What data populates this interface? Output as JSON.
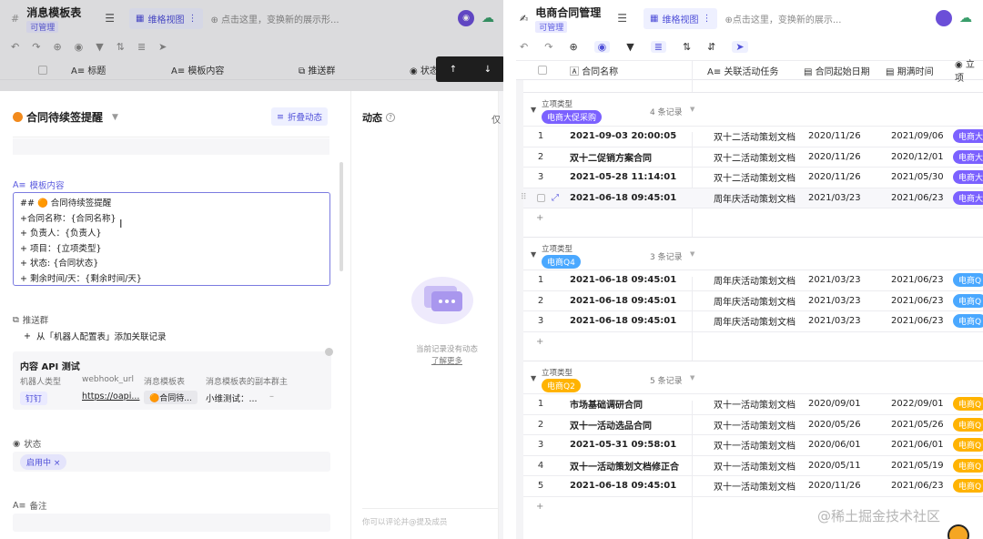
{
  "left": {
    "app_title": "消息模板表",
    "app_sub": "可管理",
    "view_tab": "维格视图",
    "add_view": "点击这里，变换新的展示形...",
    "columns": [
      "标题",
      "模板内容",
      "推送群",
      "状态"
    ],
    "row_title_partial": "合同待续签提醒",
    "record": {
      "title": "合同待续签提醒",
      "collapse": "折叠动态",
      "activity_title": "动态",
      "activity_cut": "仅",
      "template_label": "模板内容",
      "template_lines": [
        "## 🟠 合同待续签提醒",
        "+合同名称：{合同名称}",
        "+ 负责人：{负责人}",
        "+ 项目：{立项类型}",
        "+ 状态: {合同状态}",
        "+ 剩余时间/天：{剩余时间/天}"
      ],
      "push_label": "推送群",
      "add_link": "从「机器人配置表」添加关联记录",
      "linked_title": "内容 API 测试",
      "linked_cols": [
        "机器人类型",
        "webhook_url",
        "消息模板表",
        "消息模板表的副本群主"
      ],
      "linked_vals": [
        "钉钉",
        "https://oapi...",
        "合同待...",
        "小维测试：..."
      ],
      "status_label": "状态",
      "status_value": "启用中",
      "remark_label": "备注",
      "empty_text": "当前记录没有动态",
      "learn_more": "了解更多",
      "comment_placeholder": "你可以评论并@提及成员"
    }
  },
  "right": {
    "app_title": "电商合同管理",
    "app_sub": "可管理",
    "view_tab": "维格视图",
    "add_view": "点击这里，变换新的展示...",
    "columns": [
      "合同名称",
      "关联活动任务",
      "合同起始日期",
      "期满时间",
      "立项"
    ],
    "groups": [
      {
        "label": "立项类型",
        "value": "电商大促采购",
        "count": "4 条记录",
        "tag_color": "#7b61ff",
        "tag_text": "电商大",
        "rows": [
          {
            "n": "1",
            "name": "2021-09-03 20:00:05",
            "task": "双十二活动策划文档",
            "start": "2020/11/26",
            "end": "2021/09/06"
          },
          {
            "n": "",
            "name": "双十二促销方案合同",
            "task": "双十二活动策划文档",
            "start": "2020/11/26",
            "end": "2020/12/01"
          },
          {
            "n": "3",
            "name": "2021-05-28 11:14:01",
            "task": "双十二活动策划文档",
            "start": "2020/11/26",
            "end": "2021/05/30"
          },
          {
            "n": "",
            "name": "2021-06-18 09:45:01",
            "task": "周年庆活动策划文档",
            "start": "2021/03/23",
            "end": "2021/06/23"
          }
        ]
      },
      {
        "label": "立项类型",
        "value": "电商Q4",
        "count": "3 条记录",
        "tag_color": "#4aa8ff",
        "tag_text": "电商Q",
        "rows": [
          {
            "n": "1",
            "name": "2021-06-18 09:45:01",
            "task": "周年庆活动策划文档",
            "start": "2021/03/23",
            "end": "2021/06/23"
          },
          {
            "n": "2",
            "name": "2021-06-18 09:45:01",
            "task": "周年庆活动策划文档",
            "start": "2021/03/23",
            "end": "2021/06/23"
          },
          {
            "n": "3",
            "name": "2021-06-18 09:45:01",
            "task": "周年庆活动策划文档",
            "start": "2021/03/23",
            "end": "2021/06/23"
          }
        ]
      },
      {
        "label": "立项类型",
        "value": "电商Q2",
        "count": "5 条记录",
        "tag_color": "#ffb300",
        "tag_text": "电商Q",
        "rows": [
          {
            "n": "1",
            "name": "市场基础调研合同",
            "task": "双十一活动策划文档",
            "start": "2020/09/01",
            "end": "2022/09/01"
          },
          {
            "n": "2",
            "name": "双十一活动选品合同",
            "task": "双十一活动策划文档",
            "start": "2020/05/26",
            "end": "2021/05/26"
          },
          {
            "n": "3",
            "name": "2021-05-31 09:58:01",
            "task": "双十一活动策划文档",
            "start": "2020/06/01",
            "end": "2021/06/01"
          },
          {
            "n": "4",
            "name": "双十一活动策划文档修正合同",
            "task": "双十一活动策划文档",
            "start": "2020/05/11",
            "end": "2021/05/19"
          },
          {
            "n": "5",
            "name": "2021-06-18 09:45:01",
            "task": "双十一活动策划文档",
            "start": "2020/11/26",
            "end": "2021/06/23"
          }
        ]
      }
    ],
    "watermark": "@稀土掘金技术社区"
  }
}
